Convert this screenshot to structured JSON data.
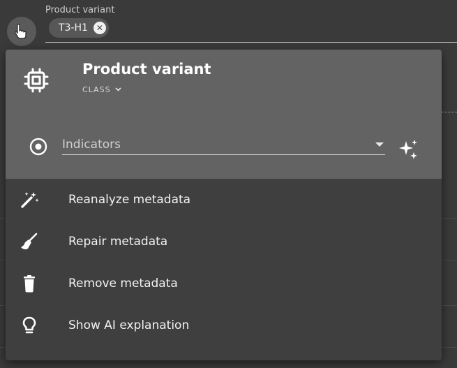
{
  "field": {
    "label": "Product variant",
    "chip_text": "T3-H1",
    "chip_close": "✕"
  },
  "menu": {
    "title": "Product variant",
    "class_label": "CLASS",
    "class_chevron": "⌄",
    "indicators_placeholder": "Indicators",
    "items": [
      {
        "label": "Reanalyze metadata",
        "icon": "magic-wand-icon"
      },
      {
        "label": "Repair metadata",
        "icon": "broom-icon"
      },
      {
        "label": "Remove metadata",
        "icon": "trash-icon"
      },
      {
        "label": "Show AI explanation",
        "icon": "lightbulb-icon"
      }
    ]
  },
  "colors": {
    "background": "#3a3a3a",
    "menu_header": "#636363",
    "menu_body": "#3f3f3f"
  }
}
